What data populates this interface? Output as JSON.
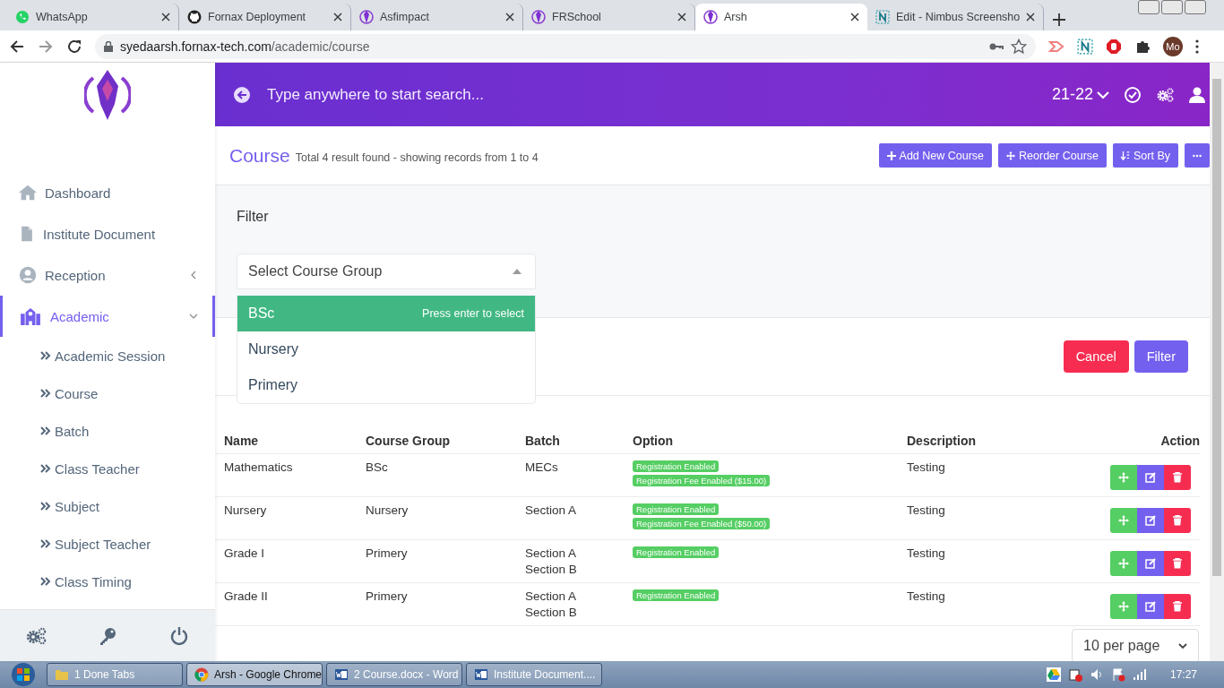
{
  "browser": {
    "tabs": [
      {
        "title": "WhatsApp",
        "kind": "chat",
        "selected": false
      },
      {
        "title": "Fornax Deployment",
        "kind": "repo",
        "selected": false
      },
      {
        "title": "Asfimpact",
        "kind": "app",
        "selected": false
      },
      {
        "title": "FRSchool",
        "kind": "app",
        "selected": false
      },
      {
        "title": "Arsh",
        "kind": "app",
        "selected": true
      },
      {
        "title": "Edit - Nimbus Screensho",
        "kind": "editor",
        "selected": false
      }
    ],
    "url_host": "syedaarsh.fornax-tech.com",
    "url_path": "/academic/course",
    "profile": "Mo"
  },
  "header": {
    "search_placeholder": "Type anywhere to start search...",
    "session": "21-22"
  },
  "sidebar": {
    "items": [
      {
        "label": "Dashboard",
        "kind": "home",
        "selected": false
      },
      {
        "label": "Institute Document",
        "kind": "document",
        "selected": false
      },
      {
        "label": "Reception",
        "kind": "people",
        "selected": false,
        "expanded": false
      },
      {
        "label": "Academic",
        "kind": "school",
        "selected": true,
        "expanded": true,
        "children": [
          {
            "label": "Academic Session"
          },
          {
            "label": "Course"
          },
          {
            "label": "Batch"
          },
          {
            "label": "Class Teacher"
          },
          {
            "label": "Subject"
          },
          {
            "label": "Subject Teacher"
          },
          {
            "label": "Class Timing"
          }
        ]
      }
    ]
  },
  "page": {
    "title": "Course",
    "summary": "Total 4 result found - showing records from 1 to 4",
    "actions": [
      {
        "label": "Add New Course",
        "kind": "add"
      },
      {
        "label": "Reorder Course",
        "kind": "reorder"
      },
      {
        "label": "Sort By",
        "kind": "sort"
      },
      {
        "kind": "more"
      }
    ]
  },
  "filter": {
    "title": "Filter",
    "select_placeholder": "Select Course Group",
    "hint": "Press enter to select",
    "options": [
      {
        "label": "BSc",
        "selected": true
      },
      {
        "label": "Nursery",
        "selected": false
      },
      {
        "label": "Primery",
        "selected": false
      }
    ],
    "buttons": [
      {
        "label": "Cancel",
        "kind": "danger"
      },
      {
        "label": "Filter",
        "kind": "primary"
      }
    ]
  },
  "table": {
    "columns": [
      "Name",
      "Course Group",
      "Batch",
      "Option",
      "Description",
      "Action"
    ],
    "rows": [
      {
        "name": "Mathematics",
        "course_group": "BSc",
        "batch": [
          "MECs"
        ],
        "options": [
          "Registration Enabled",
          "Registration Fee Enabled ($15.00)"
        ],
        "description": "Testing"
      },
      {
        "name": "Nursery",
        "course_group": "Nursery",
        "batch": [
          "Section A"
        ],
        "options": [
          "Registration Enabled",
          "Registration Fee Enabled ($50.00)"
        ],
        "description": "Testing"
      },
      {
        "name": "Grade I",
        "course_group": "Primery",
        "batch": [
          "Section A",
          "Section B"
        ],
        "options": [
          "Registration Enabled"
        ],
        "description": "Testing"
      },
      {
        "name": "Grade II",
        "course_group": "Primery",
        "batch": [
          "Section A",
          "Section B"
        ],
        "options": [
          "Registration Enabled"
        ],
        "description": "Testing"
      }
    ]
  },
  "pagination": {
    "per_page": "10 per page"
  },
  "taskbar": {
    "items": [
      {
        "label": "1 Done Tabs",
        "kind": "folder",
        "selected": false
      },
      {
        "label": "Arsh - Google Chrome",
        "kind": "browser",
        "selected": true
      },
      {
        "label": "2 Course.docx - Word",
        "kind": "document",
        "selected": false
      },
      {
        "label": "Institute Document....",
        "kind": "document",
        "selected": false
      }
    ],
    "time": "17:27"
  }
}
